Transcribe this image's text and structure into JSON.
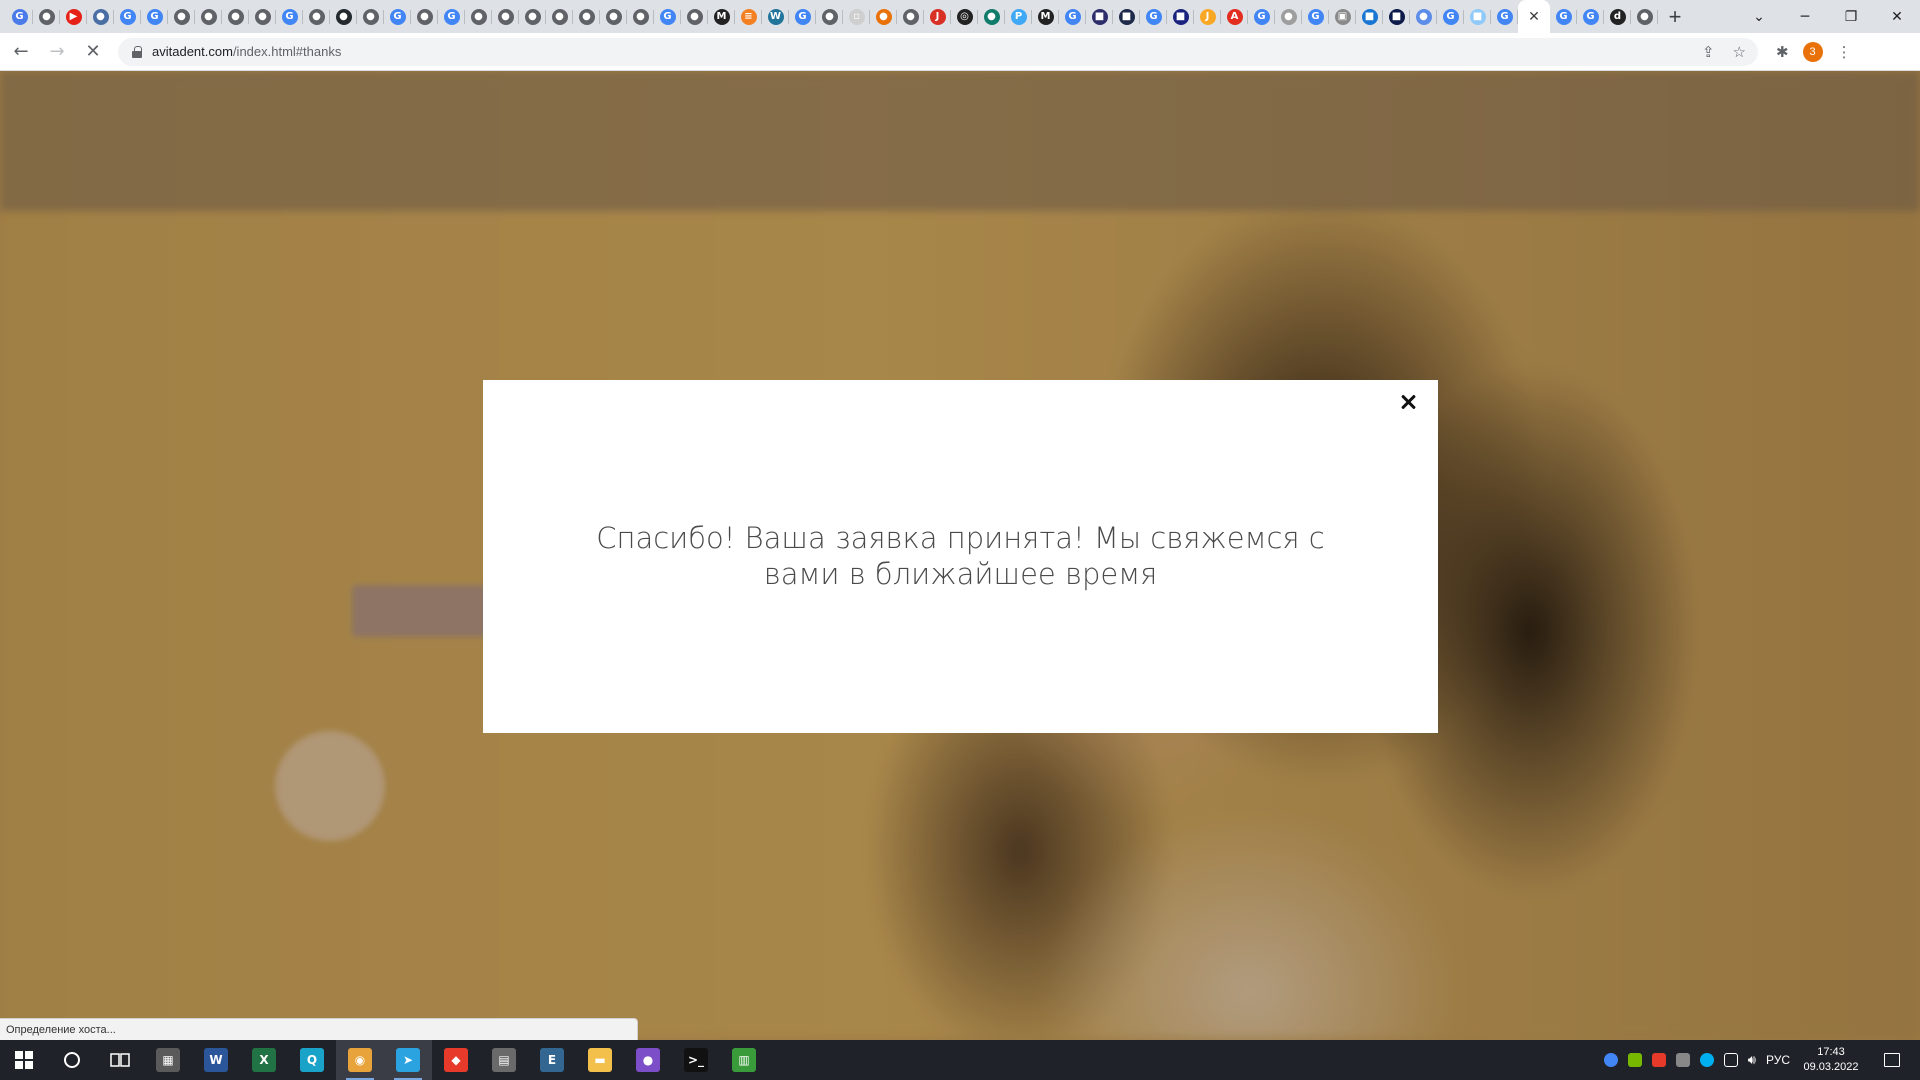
{
  "browser": {
    "favicons": [
      {
        "name": "translate-icon",
        "color": "#4a7be8",
        "glyph": "G"
      },
      {
        "name": "site-icon",
        "color": "#5f6368",
        "glyph": "●"
      },
      {
        "name": "youtube-icon",
        "color": "#e62117",
        "glyph": "▶"
      },
      {
        "name": "globe-icon",
        "color": "#4a6fa5",
        "glyph": "●"
      },
      {
        "name": "google-icon",
        "color": "#4285f4",
        "glyph": "G"
      },
      {
        "name": "google-icon",
        "color": "#4285f4",
        "glyph": "G"
      },
      {
        "name": "site-icon",
        "color": "#5f6368",
        "glyph": "●"
      },
      {
        "name": "site-icon",
        "color": "#5f6368",
        "glyph": "●"
      },
      {
        "name": "site-icon",
        "color": "#5f6368",
        "glyph": "●"
      },
      {
        "name": "site-icon",
        "color": "#5f6368",
        "glyph": "●"
      },
      {
        "name": "google-icon",
        "color": "#4285f4",
        "glyph": "G"
      },
      {
        "name": "site-icon",
        "color": "#5f6368",
        "glyph": "●"
      },
      {
        "name": "github-icon",
        "color": "#24292e",
        "glyph": "●"
      },
      {
        "name": "site-icon",
        "color": "#5f6368",
        "glyph": "●"
      },
      {
        "name": "google-icon",
        "color": "#4285f4",
        "glyph": "G"
      },
      {
        "name": "site-icon",
        "color": "#5f6368",
        "glyph": "●"
      },
      {
        "name": "google-icon",
        "color": "#4285f4",
        "glyph": "G"
      },
      {
        "name": "site-icon",
        "color": "#5f6368",
        "glyph": "●"
      },
      {
        "name": "site-icon",
        "color": "#5f6368",
        "glyph": "●"
      },
      {
        "name": "site-icon",
        "color": "#5f6368",
        "glyph": "●"
      },
      {
        "name": "site-icon",
        "color": "#5f6368",
        "glyph": "●"
      },
      {
        "name": "site-icon",
        "color": "#5f6368",
        "glyph": "●"
      },
      {
        "name": "site-icon",
        "color": "#5f6368",
        "glyph": "●"
      },
      {
        "name": "site-icon",
        "color": "#5f6368",
        "glyph": "●"
      },
      {
        "name": "google-icon",
        "color": "#4285f4",
        "glyph": "G"
      },
      {
        "name": "site-icon",
        "color": "#5f6368",
        "glyph": "●"
      },
      {
        "name": "medium-icon",
        "color": "#222",
        "glyph": "M"
      },
      {
        "name": "stackoverflow-icon",
        "color": "#f48024",
        "glyph": "≡"
      },
      {
        "name": "wordpress-icon",
        "color": "#21759b",
        "glyph": "W"
      },
      {
        "name": "google-icon",
        "color": "#4285f4",
        "glyph": "G"
      },
      {
        "name": "site-icon",
        "color": "#5f6368",
        "glyph": "●"
      },
      {
        "name": "doc-icon",
        "color": "#cfcfcf",
        "glyph": "▫"
      },
      {
        "name": "site-icon",
        "color": "#e8710a",
        "glyph": "●"
      },
      {
        "name": "site-icon",
        "color": "#5f6368",
        "glyph": "●"
      },
      {
        "name": "site-icon",
        "color": "#d93025",
        "glyph": "J"
      },
      {
        "name": "chatgpt-icon",
        "color": "#222",
        "glyph": "◎"
      },
      {
        "name": "site-icon",
        "color": "#107c6b",
        "glyph": "●"
      },
      {
        "name": "site-icon",
        "color": "#3fa9f5",
        "glyph": "P"
      },
      {
        "name": "medium-icon",
        "color": "#222",
        "glyph": "M"
      },
      {
        "name": "google-icon",
        "color": "#4285f4",
        "glyph": "G"
      },
      {
        "name": "site-icon",
        "color": "#2d2d6b",
        "glyph": "■"
      },
      {
        "name": "site-icon",
        "color": "#1e2a4a",
        "glyph": "■"
      },
      {
        "name": "google-icon",
        "color": "#4285f4",
        "glyph": "G"
      },
      {
        "name": "site-icon",
        "color": "#1a237e",
        "glyph": "■"
      },
      {
        "name": "site-icon",
        "color": "#f9a825",
        "glyph": "J"
      },
      {
        "name": "adobe-icon",
        "color": "#e22d1f",
        "glyph": "A"
      },
      {
        "name": "google-icon",
        "color": "#4285f4",
        "glyph": "G"
      },
      {
        "name": "site-icon",
        "color": "#9e9e9e",
        "glyph": "●"
      },
      {
        "name": "google-icon",
        "color": "#4285f4",
        "glyph": "G"
      },
      {
        "name": "site-icon",
        "color": "#8a8a8a",
        "glyph": "▣"
      },
      {
        "name": "site-icon",
        "color": "#1976d2",
        "glyph": "■"
      },
      {
        "name": "site-icon",
        "color": "#0d1b4a",
        "glyph": "■"
      },
      {
        "name": "site-icon",
        "color": "#5c8de8",
        "glyph": "●"
      },
      {
        "name": "google-icon",
        "color": "#4285f4",
        "glyph": "G"
      },
      {
        "name": "site-icon",
        "color": "#90caf9",
        "glyph": "■"
      },
      {
        "name": "google-icon",
        "color": "#4285f4",
        "glyph": "G"
      }
    ],
    "favicons_after": [
      {
        "name": "google-icon",
        "color": "#4285f4",
        "glyph": "G"
      },
      {
        "name": "google-icon",
        "color": "#4285f4",
        "glyph": "G"
      },
      {
        "name": "site-icon",
        "color": "#222",
        "glyph": "d"
      },
      {
        "name": "site-icon",
        "color": "#5f6368",
        "glyph": "●"
      }
    ],
    "active_tab_close": "✕",
    "new_tab": "+",
    "window_controls": {
      "tab_search": "⌄",
      "minimize": "─",
      "maximize": "❐",
      "close": "✕"
    },
    "nav": {
      "back": "←",
      "forward": "→",
      "reload": "✕"
    },
    "url_host": "avitadent.com",
    "url_path": "/index.html#thanks",
    "omni_icons": {
      "share": "⇪",
      "bookmark": "☆"
    },
    "extensions_icon": "✱",
    "profile_badge": "3",
    "menu_icon": "⋮"
  },
  "modal": {
    "message": "Спасибо! Ваша заявка принята! Мы свяжемся с вами в ближайшее время"
  },
  "status_bar": "Определение хоста...",
  "taskbar": {
    "apps": [
      {
        "name": "calculator-icon",
        "color": "#5a5a5a",
        "glyph": "▦"
      },
      {
        "name": "word-icon",
        "color": "#2b579a",
        "glyph": "W"
      },
      {
        "name": "excel-icon",
        "color": "#217346",
        "glyph": "X"
      },
      {
        "name": "search-app-icon",
        "color": "#1aa3c8",
        "glyph": "Q"
      },
      {
        "name": "chrome-icon",
        "color": "#e8a33a",
        "glyph": "◉"
      },
      {
        "name": "telegram-icon",
        "color": "#2aa3e0",
        "glyph": "➤"
      },
      {
        "name": "anydesk-icon",
        "color": "#e83a2a",
        "glyph": "◆"
      },
      {
        "name": "file-manager-icon",
        "color": "#6a6a6a",
        "glyph": "▤"
      },
      {
        "name": "postgres-icon",
        "color": "#336791",
        "glyph": "E"
      },
      {
        "name": "folder-icon",
        "color": "#f3c14b",
        "glyph": "▬"
      },
      {
        "name": "github-desktop-icon",
        "color": "#7c4fc8",
        "glyph": "●"
      },
      {
        "name": "terminal-icon",
        "color": "#111",
        "glyph": ">_"
      },
      {
        "name": "notepad-icon",
        "color": "#3a9b3a",
        "glyph": "▥"
      }
    ],
    "language": "РУС",
    "time": "17:43",
    "date": "09.03.2022"
  }
}
